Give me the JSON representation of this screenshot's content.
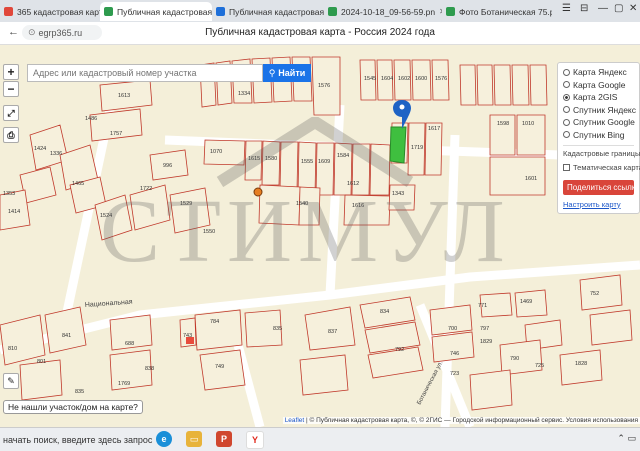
{
  "browser": {
    "tabs": [
      {
        "label": "365 кадастровая карта",
        "active": false,
        "color": "#e0473a"
      },
      {
        "label": "Публичная кадастровая карта",
        "active": true,
        "color": "#2e9b4e"
      },
      {
        "label": "Публичная кадастровая",
        "active": false,
        "color": "#1e6fd9"
      },
      {
        "label": "2024-10-18_09-56-59.pn",
        "active": false,
        "color": "#2e9b4e"
      },
      {
        "label": "Фото Ботаничеcкая 75.p",
        "active": false,
        "color": "#2e9b4e"
      }
    ],
    "url": "egrp365.ru",
    "page_title": "Публичная кадастровая карта - Россия 2024 года"
  },
  "map": {
    "search_placeholder": "Адрес или кадастровый номер участка",
    "search_button": "Найти",
    "zoom_in": "+",
    "zoom_out": "−",
    "layers": [
      "Карта Яндекс",
      "Карта Google",
      "Карта 2GIS",
      "Спутник Яндекс",
      "Спутник Google",
      "Спутник Bing"
    ],
    "selected_layer": "Карта 2GIS",
    "cadastral_borders": "Кадастровые границы",
    "thematic_map": "Тематическая карта",
    "share_button": "Поделиться ссылкой",
    "settings_link": "Настроить карту",
    "not_found": "Не нашли участок/дом на карте?",
    "street_label": "Национальная",
    "street_label_2": "Ботаническая ул.",
    "watermark": "СТИМУЛ",
    "attribution_leaflet": "Leaflet",
    "attribution_text": "| © Публичная кадастровая карта, ©, © 2ГИС — Городской информационный сервис. Условия использования",
    "parcel_numbers": [
      "1613",
      "1519",
      "1518",
      "1560",
      "1334",
      "1522",
      "1576",
      "1545",
      "1604",
      "1602",
      "1600",
      "1576",
      "1598",
      "1010",
      "1070",
      "1580",
      "1584",
      "1617",
      "1719",
      "1615",
      "1555",
      "1609",
      "1601",
      "996",
      "1540",
      "1612",
      "1616",
      "1343",
      "1722",
      "1529",
      "1550",
      "1336",
      "1465",
      "1757",
      "1486",
      "1424",
      "1353",
      "1414",
      "1524",
      "1469",
      "752",
      "688",
      "810",
      "841",
      "834",
      "700",
      "746",
      "723",
      "725",
      "790",
      "801",
      "838",
      "743",
      "784",
      "835",
      "837",
      "792",
      "749",
      "835",
      "797",
      "1829",
      "1828",
      "771",
      "1769",
      "1031"
    ]
  },
  "taskbar": {
    "search_text": "начать поиск, введите здесь запрос",
    "apps": [
      "Edge",
      "Files",
      "PowerPoint",
      "Yandex"
    ]
  },
  "colors": {
    "accent": "#1a73e8",
    "share": "#d9453a",
    "parcel_border": "#c0392b",
    "map_bg": "#f4efd9"
  }
}
